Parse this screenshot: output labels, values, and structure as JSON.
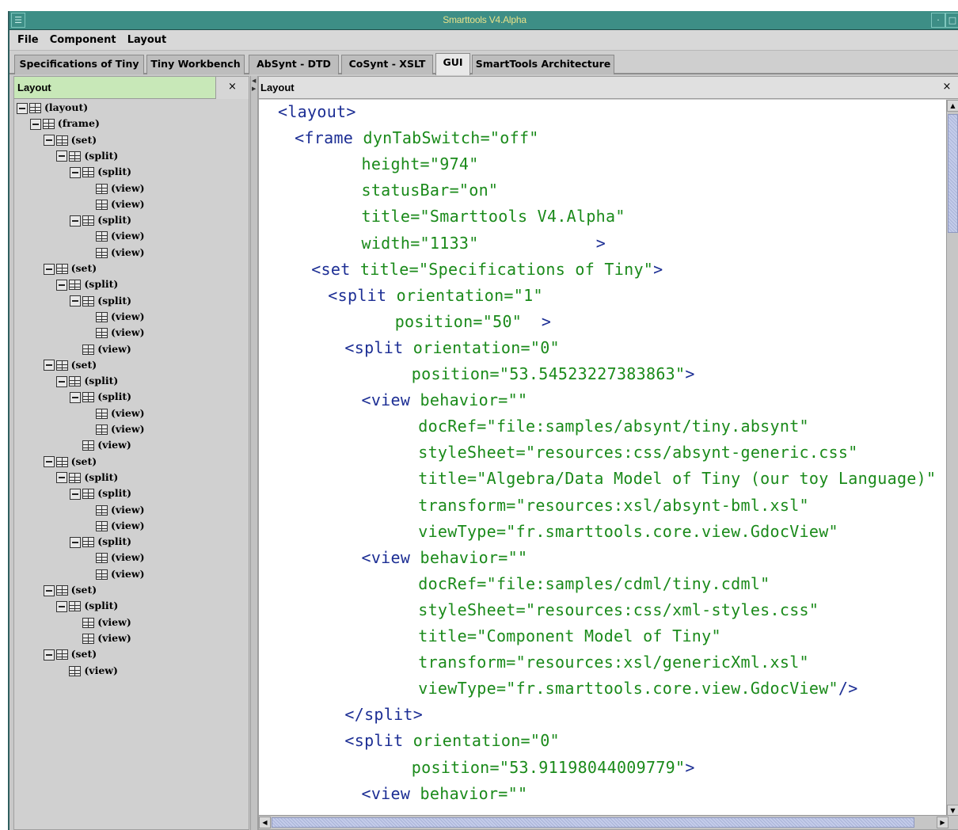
{
  "window": {
    "title": "Smarttools V4.Alpha"
  },
  "menubar": {
    "items": [
      "File",
      "Component",
      "Layout"
    ]
  },
  "tabs": [
    {
      "label": "Specifications of Tiny",
      "active": false
    },
    {
      "label": "Tiny Workbench",
      "active": false
    },
    {
      "label": "AbSynt - DTD",
      "active": false
    },
    {
      "label": "CoSynt - XSLT",
      "active": false
    },
    {
      "label": "GUI",
      "active": true
    },
    {
      "label": "SmartTools Architecture",
      "active": false
    }
  ],
  "left_panel": {
    "title": "Layout",
    "close_label": "×",
    "tree": [
      {
        "label": "(layout)",
        "depth": 0,
        "expandable": true
      },
      {
        "label": "(frame)",
        "depth": 1,
        "expandable": true
      },
      {
        "label": "(set)",
        "depth": 2,
        "expandable": true
      },
      {
        "label": "(split)",
        "depth": 3,
        "expandable": true
      },
      {
        "label": "(split)",
        "depth": 4,
        "expandable": true
      },
      {
        "label": "(view)",
        "depth": 5,
        "expandable": false
      },
      {
        "label": "(view)",
        "depth": 5,
        "expandable": false
      },
      {
        "label": "(split)",
        "depth": 4,
        "expandable": true
      },
      {
        "label": "(view)",
        "depth": 5,
        "expandable": false
      },
      {
        "label": "(view)",
        "depth": 5,
        "expandable": false
      },
      {
        "label": "(set)",
        "depth": 2,
        "expandable": true
      },
      {
        "label": "(split)",
        "depth": 3,
        "expandable": true
      },
      {
        "label": "(split)",
        "depth": 4,
        "expandable": true
      },
      {
        "label": "(view)",
        "depth": 5,
        "expandable": false
      },
      {
        "label": "(view)",
        "depth": 5,
        "expandable": false
      },
      {
        "label": "(view)",
        "depth": 4,
        "expandable": false
      },
      {
        "label": "(set)",
        "depth": 2,
        "expandable": true
      },
      {
        "label": "(split)",
        "depth": 3,
        "expandable": true
      },
      {
        "label": "(split)",
        "depth": 4,
        "expandable": true
      },
      {
        "label": "(view)",
        "depth": 5,
        "expandable": false
      },
      {
        "label": "(view)",
        "depth": 5,
        "expandable": false
      },
      {
        "label": "(view)",
        "depth": 4,
        "expandable": false
      },
      {
        "label": "(set)",
        "depth": 2,
        "expandable": true
      },
      {
        "label": "(split)",
        "depth": 3,
        "expandable": true
      },
      {
        "label": "(split)",
        "depth": 4,
        "expandable": true
      },
      {
        "label": "(view)",
        "depth": 5,
        "expandable": false
      },
      {
        "label": "(view)",
        "depth": 5,
        "expandable": false
      },
      {
        "label": "(split)",
        "depth": 4,
        "expandable": true
      },
      {
        "label": "(view)",
        "depth": 5,
        "expandable": false
      },
      {
        "label": "(view)",
        "depth": 5,
        "expandable": false
      },
      {
        "label": "(set)",
        "depth": 2,
        "expandable": true
      },
      {
        "label": "(split)",
        "depth": 3,
        "expandable": true
      },
      {
        "label": "(view)",
        "depth": 4,
        "expandable": false
      },
      {
        "label": "(view)",
        "depth": 4,
        "expandable": false
      },
      {
        "label": "(set)",
        "depth": 2,
        "expandable": true
      },
      {
        "label": "(view)",
        "depth": 3,
        "expandable": false
      }
    ]
  },
  "right_panel": {
    "title": "Layout",
    "close_label": "×",
    "code": [
      {
        "indent": 0,
        "tag": "<layout>",
        "text": ""
      },
      {
        "indent": 1,
        "tag": "<frame",
        "text": " dynTabSwitch=\"off\""
      },
      {
        "indent": 5,
        "tag": "",
        "text": "height=\"974\""
      },
      {
        "indent": 5,
        "tag": "",
        "text": "statusBar=\"on\""
      },
      {
        "indent": 5,
        "tag": "",
        "text": "title=\"Smarttools V4.Alpha\""
      },
      {
        "indent": 5,
        "tag": "",
        "text": "width=\"1133\"            ",
        "tail": ">"
      },
      {
        "indent": 2,
        "tag": "<set",
        "text": " title=\"Specifications of Tiny\"",
        "tail": ">"
      },
      {
        "indent": 3,
        "tag": "<split",
        "text": " orientation=\"1\""
      },
      {
        "indent": 7,
        "tag": "",
        "text": "position=\"50\"  ",
        "tail": ">"
      },
      {
        "indent": 4,
        "tag": "<split",
        "text": " orientation=\"0\""
      },
      {
        "indent": 8,
        "tag": "",
        "text": "position=\"53.54523227383863\"",
        "tail": ">"
      },
      {
        "indent": 5,
        "tag": "<view",
        "text": " behavior=\"\""
      },
      {
        "indent": 8.4,
        "tag": "",
        "text": "docRef=\"file:samples/absynt/tiny.absynt\""
      },
      {
        "indent": 8.4,
        "tag": "",
        "text": "styleSheet=\"resources:css/absynt-generic.css\""
      },
      {
        "indent": 8.4,
        "tag": "",
        "text": "title=\"Algebra/Data Model of Tiny (our toy Language)\""
      },
      {
        "indent": 8.4,
        "tag": "",
        "text": "transform=\"resources:xsl/absynt-bml.xsl\""
      },
      {
        "indent": 8.4,
        "tag": "",
        "text": "viewType=\"fr.smarttools.core.view.GdocView\""
      },
      {
        "indent": 5,
        "tag": "<view",
        "text": " behavior=\"\""
      },
      {
        "indent": 8.4,
        "tag": "",
        "text": "docRef=\"file:samples/cdml/tiny.cdml\""
      },
      {
        "indent": 8.4,
        "tag": "",
        "text": "styleSheet=\"resources:css/xml-styles.css\""
      },
      {
        "indent": 8.4,
        "tag": "",
        "text": "title=\"Component Model of Tiny\""
      },
      {
        "indent": 8.4,
        "tag": "",
        "text": "transform=\"resources:xsl/genericXml.xsl\""
      },
      {
        "indent": 8.4,
        "tag": "",
        "text": "viewType=\"fr.smarttools.core.view.GdocView\"",
        "tail": "/>"
      },
      {
        "indent": 4,
        "tag": "</split>",
        "text": ""
      },
      {
        "indent": 4,
        "tag": "<split",
        "text": " orientation=\"0\""
      },
      {
        "indent": 8,
        "tag": "",
        "text": "position=\"53.91198044009779\"",
        "tail": ">"
      },
      {
        "indent": 5,
        "tag": "<view",
        "text": " behavior=\"\""
      }
    ]
  },
  "colors": {
    "titlebar": "#3d8e86",
    "title_text": "#e8e28a",
    "left_header": "#c8e8b8",
    "code_tag": "#1c2e94",
    "code_text": "#1a8a1a"
  }
}
